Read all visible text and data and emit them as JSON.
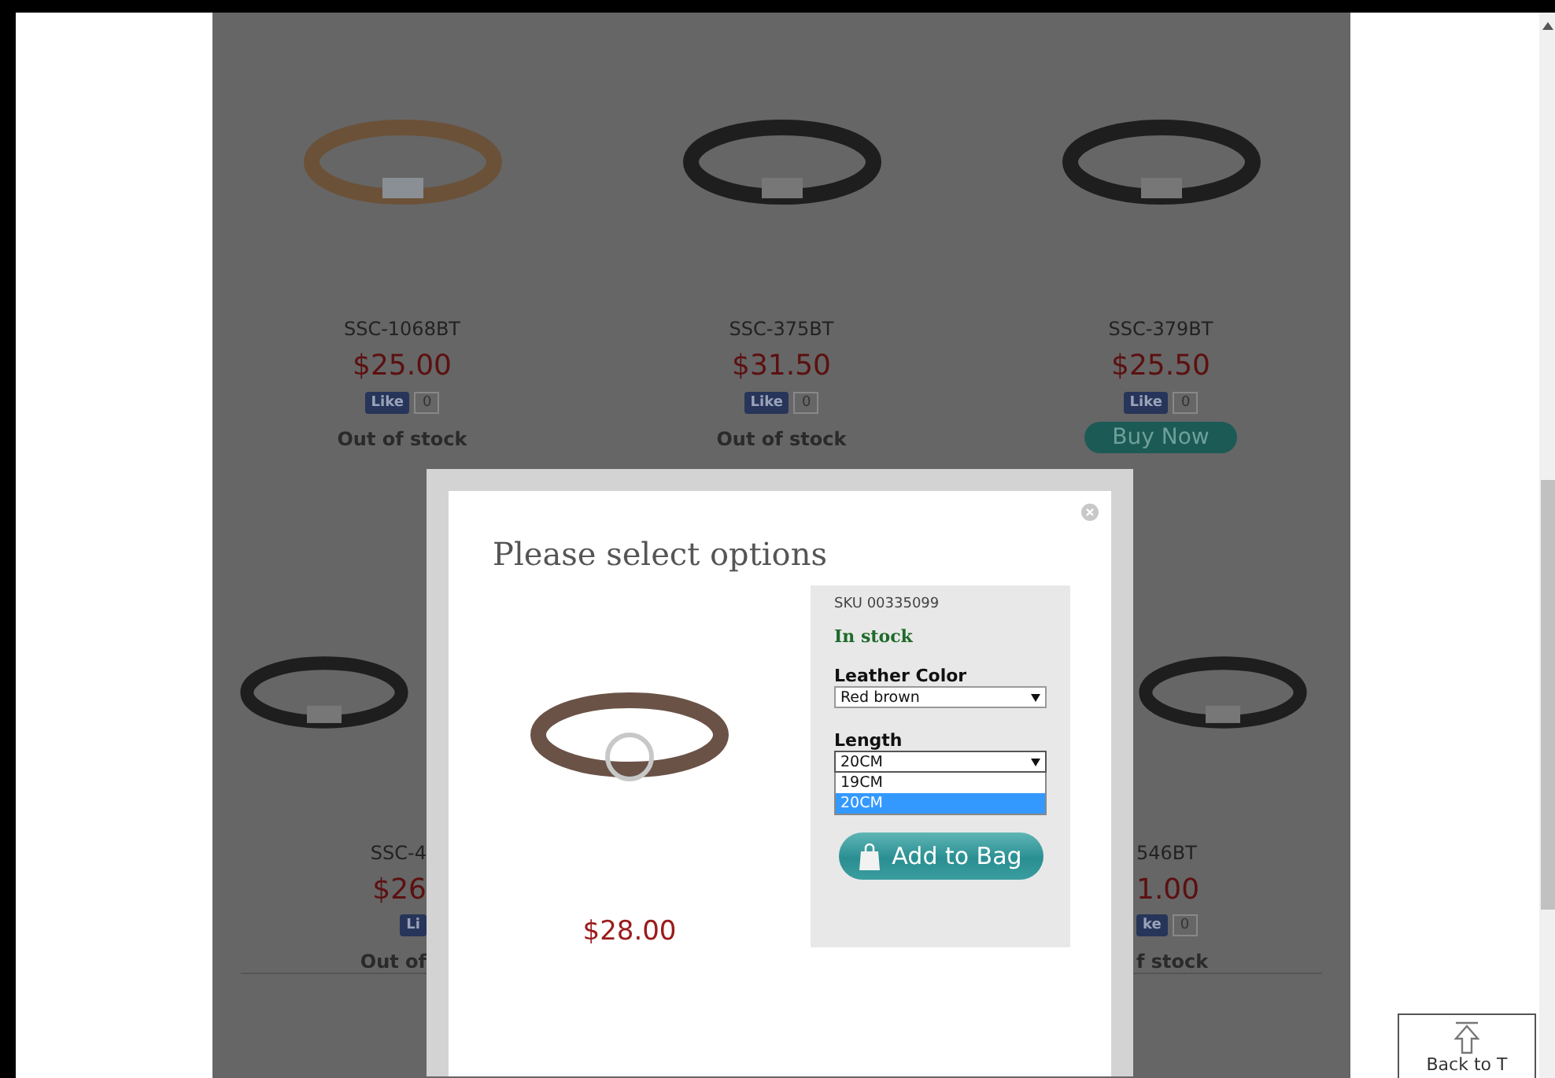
{
  "products_row_1": [
    {
      "name": "SSC-1068BT",
      "price": "$25.00",
      "like": {
        "label": "Like",
        "count": "0"
      },
      "status": {
        "kind": "text",
        "label": "Out of stock"
      }
    },
    {
      "name": "SSC-375BT",
      "price": "$31.50",
      "like": {
        "label": "Like",
        "count": "0"
      },
      "status": {
        "kind": "text",
        "label": "Out of stock"
      }
    },
    {
      "name": "SSC-379BT",
      "price": "$25.50",
      "like": {
        "label": "Like",
        "count": "0"
      },
      "status": {
        "kind": "button",
        "label": "Buy Now"
      }
    }
  ],
  "products_row_2": [
    {
      "name": "SSC-4",
      "price": "$26",
      "like": {
        "label": "Li"
      },
      "status": "Out of"
    },
    {
      "name": "546BT",
      "price": "1.00",
      "like": {
        "label": "ke",
        "count": "0"
      },
      "status": "f stock"
    }
  ],
  "modal": {
    "title": "Please select options",
    "price": "$28.00",
    "sku": "SKU 00335099",
    "stock": "In stock",
    "options": [
      {
        "label": "Leather Color",
        "value": "Red brown",
        "expanded": false
      },
      {
        "label": "Length",
        "value": "20CM",
        "expanded": true,
        "choices": [
          {
            "label": "19CM",
            "selected": false
          },
          {
            "label": "20CM",
            "selected": true
          }
        ]
      }
    ],
    "add_button": "Add to Bag"
  },
  "back_to_top": "Back to T"
}
